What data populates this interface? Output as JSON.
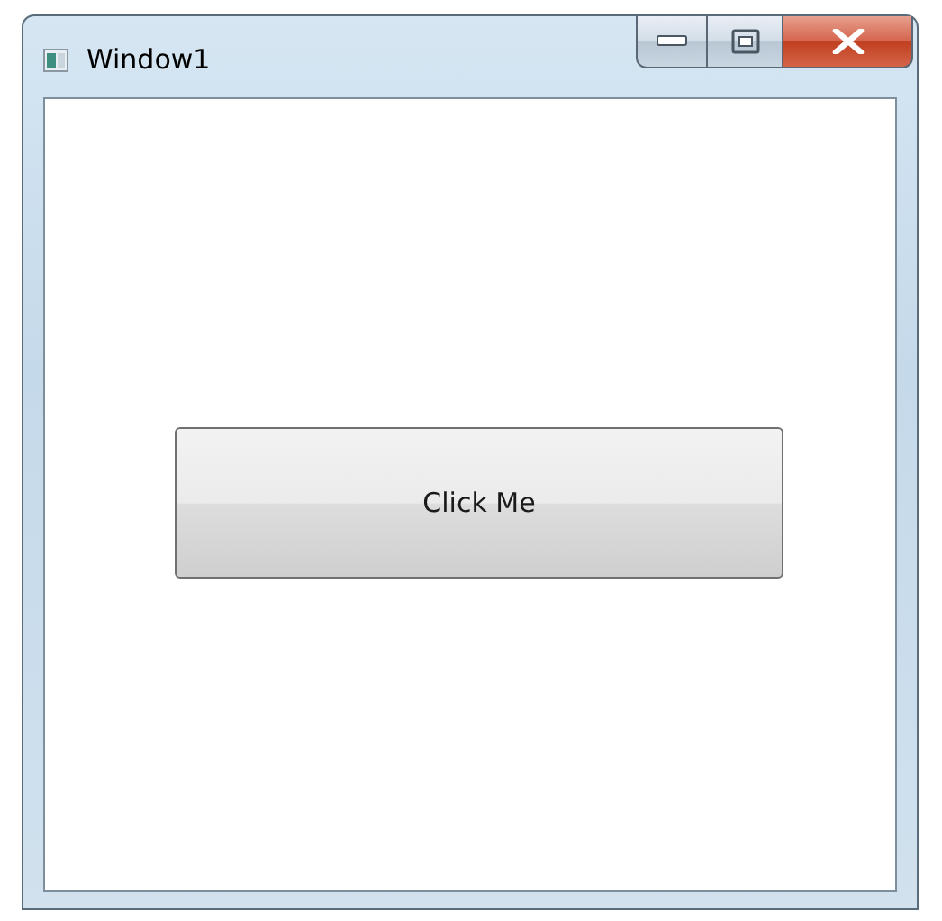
{
  "window": {
    "title": "Window1"
  },
  "button": {
    "label": "Click Me"
  }
}
